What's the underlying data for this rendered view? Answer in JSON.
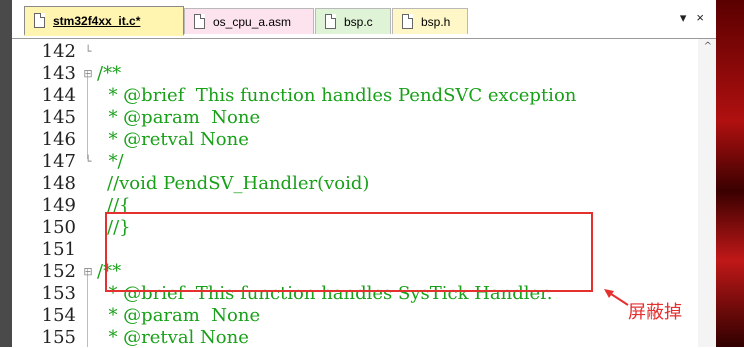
{
  "tabs": [
    {
      "label": "stm32f4xx_it.c*",
      "active": true
    },
    {
      "label": "os_cpu_a.asm",
      "active": false
    },
    {
      "label": "bsp.c",
      "active": false
    },
    {
      "label": "bsp.h",
      "active": false
    }
  ],
  "tab_tools": {
    "dropdown": "▾",
    "close": "×"
  },
  "editor": {
    "lines": [
      {
        "num": "142",
        "fold": "└",
        "text": ""
      },
      {
        "num": "143",
        "fold": "⊟",
        "text": "/**"
      },
      {
        "num": "144",
        "fold": "",
        "text": "  * @brief  This function handles PendSVC exception"
      },
      {
        "num": "145",
        "fold": "",
        "text": "  * @param  None"
      },
      {
        "num": "146",
        "fold": "",
        "text": "  * @retval None"
      },
      {
        "num": "147",
        "fold": "└",
        "text": "  */"
      },
      {
        "num": "148",
        "fold": "",
        "text": "//void PendSV_Handler(void)"
      },
      {
        "num": "149",
        "fold": "",
        "text": "//{"
      },
      {
        "num": "150",
        "fold": "",
        "text": "//}"
      },
      {
        "num": "151",
        "fold": "",
        "text": ""
      },
      {
        "num": "152",
        "fold": "⊟",
        "text": "/**"
      },
      {
        "num": "153",
        "fold": "",
        "text": "  * @brief  This function handles SysTick Handler."
      },
      {
        "num": "154",
        "fold": "",
        "text": "  * @param  None"
      },
      {
        "num": "155",
        "fold": "",
        "text": "  * @retval None"
      }
    ]
  },
  "annotation": {
    "text": "屏蔽掉",
    "color": "#e53030"
  },
  "colors": {
    "comment": "#18a018",
    "active_tab": "#fff4b0"
  }
}
